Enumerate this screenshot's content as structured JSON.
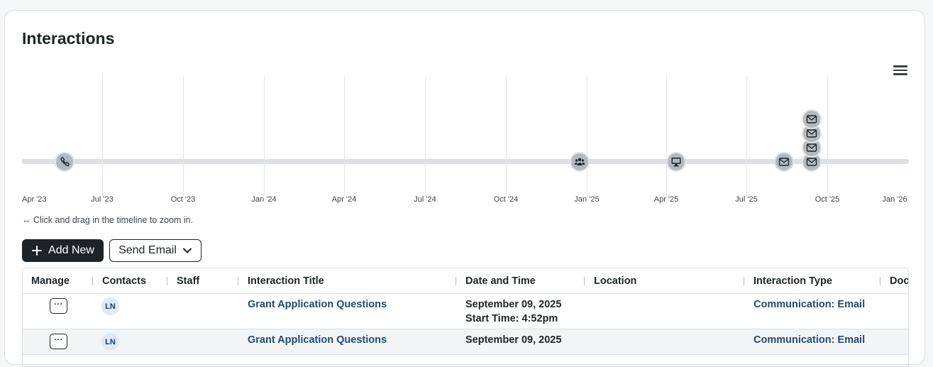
{
  "page": {
    "title": "Interactions"
  },
  "timeline": {
    "ticks": [
      "Apr '23",
      "Jul '23",
      "Oct '23",
      "Jan '24",
      "Apr '24",
      "Jul '24",
      "Oct '24",
      "Jan '25",
      "Apr '25",
      "Jul '25",
      "Oct '25",
      "Jan '26"
    ],
    "events": [
      {
        "icon": "phone-icon"
      },
      {
        "icon": "meeting-icon"
      },
      {
        "icon": "computer-icon"
      },
      {
        "icon": "email-icon"
      },
      {
        "icon": "email-icon"
      },
      {
        "icon": "email-icon"
      },
      {
        "icon": "email-icon"
      },
      {
        "icon": "email-icon"
      }
    ],
    "hint": "↔ Click and drag in the timeline to zoom in."
  },
  "toolbar": {
    "add_label": "Add New",
    "send_email_label": "Send Email"
  },
  "table": {
    "columns": [
      "Manage",
      "Contacts",
      "Staff",
      "Interaction Title",
      "Date and Time",
      "Location",
      "Interaction Type",
      "Doc"
    ],
    "rows": [
      {
        "contact_initials": "LN",
        "title": "Grant Application Questions",
        "date": "September 09, 2025",
        "start_time": "Start Time: 4:52pm",
        "type": "Communication: Email"
      },
      {
        "contact_initials": "LN",
        "title": "Grant Application Questions",
        "date": "September 09, 2025",
        "start_time": "",
        "type": "Communication: Email"
      }
    ]
  },
  "colors": {
    "primary": "#1d2327",
    "link": "#1f4a78",
    "marker": "#b4b9bf",
    "avatar_bg": "#dbe9f9"
  }
}
